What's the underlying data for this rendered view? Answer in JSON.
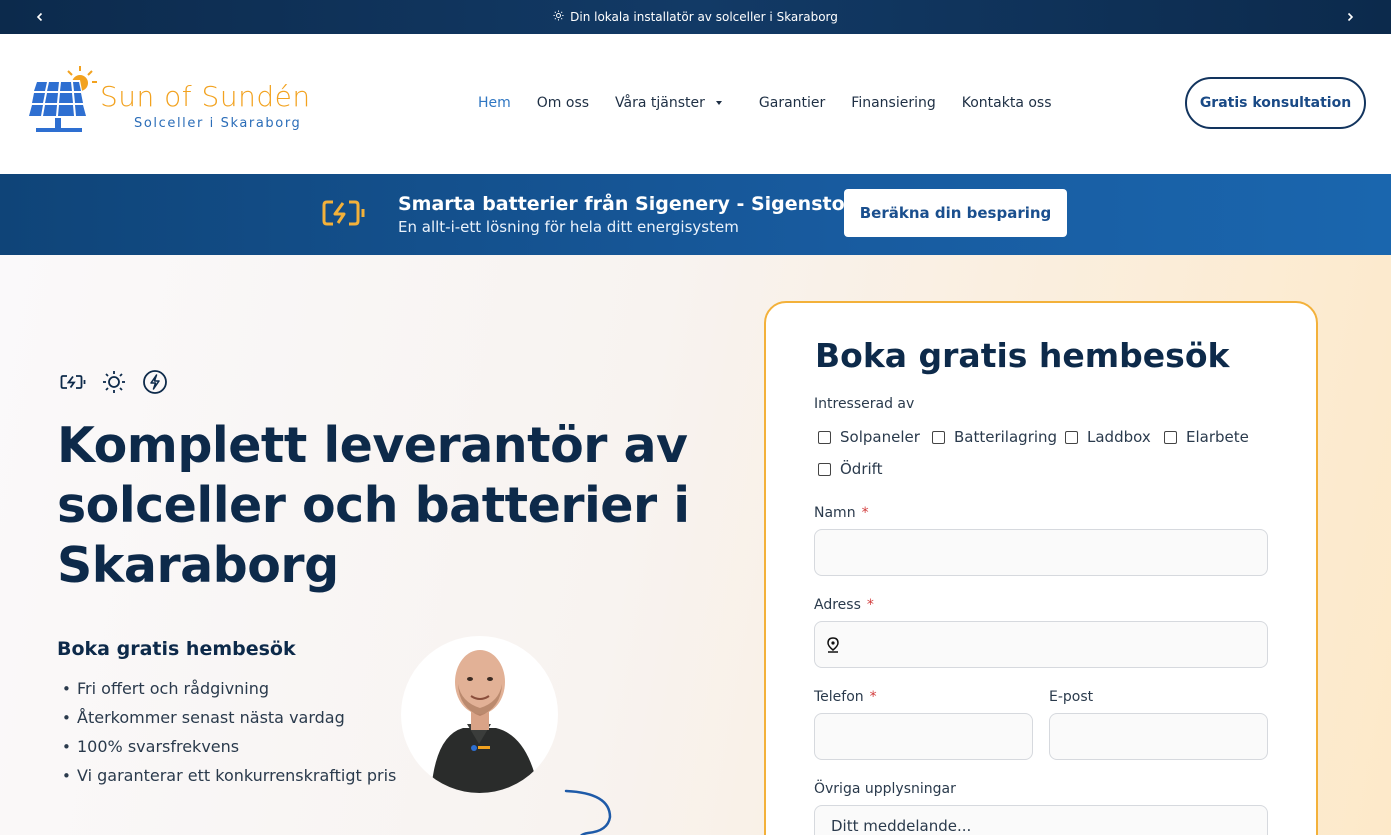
{
  "announcement": {
    "text": "Din lokala installatör av solceller i Skaraborg",
    "prev_icon": "chevron-left-icon",
    "next_icon": "chevron-right-icon"
  },
  "logo": {
    "name": "Sun of Sundén",
    "tagline": "Solceller i Skaraborg"
  },
  "nav": {
    "items": [
      {
        "label": "Hem",
        "active": true
      },
      {
        "label": "Om oss"
      },
      {
        "label": "Våra tjänster",
        "has_dropdown": true
      },
      {
        "label": "Garantier"
      },
      {
        "label": "Finansiering"
      },
      {
        "label": "Kontakta oss"
      }
    ],
    "cta": "Gratis konsultation"
  },
  "promo": {
    "title": "Smarta batterier från Sigenery - Sigenstor",
    "subtitle": "En allt-i-ett lösning för hela ditt energisystem",
    "button": "Beräkna din besparing"
  },
  "hero": {
    "icons": [
      "battery-charging-icon",
      "sun-icon",
      "lightning-icon"
    ],
    "title": "Komplett leverantör av solceller och batterier i Skaraborg",
    "subheading": "Boka gratis hembesök",
    "bullets": [
      "Fri offert och rådgivning",
      "Återkommer senast nästa vardag",
      "100% svarsfrekvens",
      "Vi garanterar ett konkurrenskraftigt pris"
    ]
  },
  "form": {
    "title": "Boka gratis hembesök",
    "interest_label": "Intresserad av",
    "options": [
      "Solpaneler",
      "Batterilagring",
      "Laddbox",
      "Elarbete",
      "Ödrift"
    ],
    "name_label": "Namn",
    "address_label": "Adress",
    "phone_label": "Telefon",
    "email_label": "E-post",
    "other_label": "Övriga upplysningar",
    "message_placeholder": "Ditt meddelande...",
    "required_mark": "*"
  },
  "colors": {
    "navy": "#0d2a4a",
    "accent_blue": "#2f76c2",
    "orange": "#f3b13a",
    "promo_blue": "#185b9f"
  }
}
